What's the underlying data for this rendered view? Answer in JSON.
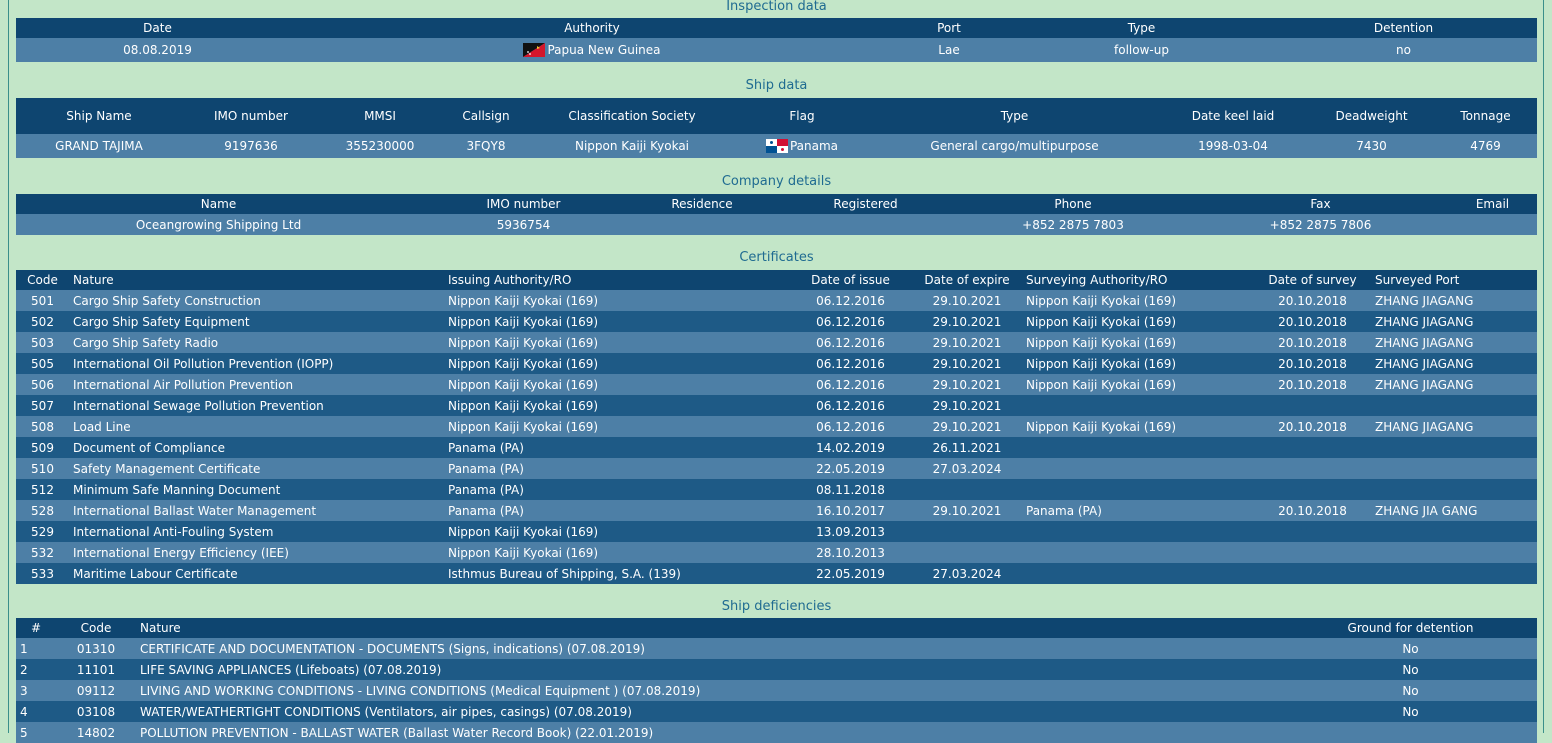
{
  "inspection": {
    "title": "Inspection data",
    "headers": [
      "Date",
      "Authority",
      "Port",
      "Type",
      "Detention"
    ],
    "row": {
      "date": "08.08.2019",
      "authority": "Papua New Guinea",
      "port": "Lae",
      "type": "follow-up",
      "detention": "no"
    }
  },
  "ship": {
    "title": "Ship data",
    "headers": [
      "Ship Name",
      "IMO number",
      "MMSI",
      "Callsign",
      "Classification Society",
      "Flag",
      "Type",
      "Date keel laid",
      "Deadweight",
      "Tonnage"
    ],
    "row": {
      "name": "GRAND TAJIMA",
      "imo": "9197636",
      "mmsi": "355230000",
      "callsign": "3FQY8",
      "class": "Nippon Kaiji Kyokai",
      "flag": "Panama",
      "type": "General cargo/multipurpose",
      "keel": "1998-03-04",
      "dwt": "7430",
      "tonnage": "4769"
    }
  },
  "company": {
    "title": "Company details",
    "headers": [
      "Name",
      "IMO number",
      "Residence",
      "Registered",
      "Phone",
      "Fax",
      "Email"
    ],
    "row": {
      "name": "Oceangrowing Shipping Ltd",
      "imo": "5936754",
      "residence": "",
      "registered": "",
      "phone": "+852 2875 7803",
      "fax": "+852 2875 7806",
      "email": ""
    }
  },
  "certificates": {
    "title": "Certificates",
    "headers": [
      "Code",
      "Nature",
      "Issuing Authority/RO",
      "Date of issue",
      "Date of expire",
      "Surveying Authority/RO",
      "Date of survey",
      "Surveyed Port"
    ],
    "rows": [
      {
        "code": "501",
        "nature": "Cargo Ship Safety Construction",
        "issuer": "Nippon Kaiji Kyokai (169)",
        "issue": "06.12.2016",
        "expire": "29.10.2021",
        "surveyor": "Nippon Kaiji Kyokai (169)",
        "survey": "20.10.2018",
        "port": "ZHANG JIAGANG"
      },
      {
        "code": "502",
        "nature": "Cargo Ship Safety Equipment",
        "issuer": "Nippon Kaiji Kyokai (169)",
        "issue": "06.12.2016",
        "expire": "29.10.2021",
        "surveyor": "Nippon Kaiji Kyokai (169)",
        "survey": "20.10.2018",
        "port": "ZHANG JIAGANG"
      },
      {
        "code": "503",
        "nature": "Cargo Ship Safety Radio",
        "issuer": "Nippon Kaiji Kyokai (169)",
        "issue": "06.12.2016",
        "expire": "29.10.2021",
        "surveyor": "Nippon Kaiji Kyokai (169)",
        "survey": "20.10.2018",
        "port": "ZHANG JIAGANG"
      },
      {
        "code": "505",
        "nature": "International Oil Pollution Prevention (IOPP)",
        "issuer": "Nippon Kaiji Kyokai (169)",
        "issue": "06.12.2016",
        "expire": "29.10.2021",
        "surveyor": "Nippon Kaiji Kyokai (169)",
        "survey": "20.10.2018",
        "port": "ZHANG JIAGANG"
      },
      {
        "code": "506",
        "nature": "International Air Pollution Prevention",
        "issuer": "Nippon Kaiji Kyokai (169)",
        "issue": "06.12.2016",
        "expire": "29.10.2021",
        "surveyor": "Nippon Kaiji Kyokai (169)",
        "survey": "20.10.2018",
        "port": "ZHANG JIAGANG"
      },
      {
        "code": "507",
        "nature": "International Sewage Pollution Prevention",
        "issuer": "Nippon Kaiji Kyokai (169)",
        "issue": "06.12.2016",
        "expire": "29.10.2021",
        "surveyor": "",
        "survey": "",
        "port": ""
      },
      {
        "code": "508",
        "nature": "Load Line",
        "issuer": "Nippon Kaiji Kyokai (169)",
        "issue": "06.12.2016",
        "expire": "29.10.2021",
        "surveyor": "Nippon Kaiji Kyokai (169)",
        "survey": "20.10.2018",
        "port": "ZHANG JIAGANG"
      },
      {
        "code": "509",
        "nature": "Document of Compliance",
        "issuer": "Panama (PA)",
        "issue": "14.02.2019",
        "expire": "26.11.2021",
        "surveyor": "",
        "survey": "",
        "port": ""
      },
      {
        "code": "510",
        "nature": "Safety Management Certificate",
        "issuer": "Panama (PA)",
        "issue": "22.05.2019",
        "expire": "27.03.2024",
        "surveyor": "",
        "survey": "",
        "port": ""
      },
      {
        "code": "512",
        "nature": "Minimum Safe Manning Document",
        "issuer": "Panama (PA)",
        "issue": "08.11.2018",
        "expire": "",
        "surveyor": "",
        "survey": "",
        "port": ""
      },
      {
        "code": "528",
        "nature": "International Ballast Water Management",
        "issuer": "Panama (PA)",
        "issue": "16.10.2017",
        "expire": "29.10.2021",
        "surveyor": "Panama (PA)",
        "survey": "20.10.2018",
        "port": "ZHANG JIA GANG"
      },
      {
        "code": "529",
        "nature": "International Anti-Fouling System",
        "issuer": "Nippon Kaiji Kyokai (169)",
        "issue": "13.09.2013",
        "expire": "",
        "surveyor": "",
        "survey": "",
        "port": ""
      },
      {
        "code": "532",
        "nature": "International Energy Efficiency (IEE)",
        "issuer": "Nippon Kaiji Kyokai (169)",
        "issue": "28.10.2013",
        "expire": "",
        "surveyor": "",
        "survey": "",
        "port": ""
      },
      {
        "code": "533",
        "nature": "Maritime Labour Certificate",
        "issuer": "Isthmus Bureau of Shipping, S.A. (139)",
        "issue": "22.05.2019",
        "expire": "27.03.2024",
        "surveyor": "",
        "survey": "",
        "port": ""
      }
    ]
  },
  "deficiencies": {
    "title": "Ship deficiencies",
    "headers": [
      "#",
      "Code",
      "Nature",
      "Ground for detention"
    ],
    "rows": [
      {
        "n": "1",
        "code": "01310",
        "nature": "CERTIFICATE AND DOCUMENTATION - DOCUMENTS (Signs, indications) (07.08.2019)",
        "ground": "No"
      },
      {
        "n": "2",
        "code": "11101",
        "nature": "LIFE SAVING APPLIANCES (Lifeboats) (07.08.2019)",
        "ground": "No"
      },
      {
        "n": "3",
        "code": "09112",
        "nature": "LIVING AND WORKING CONDITIONS - LIVING CONDITIONS (Medical Equipment ) (07.08.2019)",
        "ground": "No"
      },
      {
        "n": "4",
        "code": "03108",
        "nature": "WATER/WEATHERTIGHT CONDITIONS (Ventilators, air pipes, casings) (07.08.2019)",
        "ground": "No"
      },
      {
        "n": "5",
        "code": "14802",
        "nature": "POLLUTION PREVENTION - BALLAST WATER (Ballast Water Record Book) (22.01.2019)",
        "ground": ""
      }
    ]
  }
}
